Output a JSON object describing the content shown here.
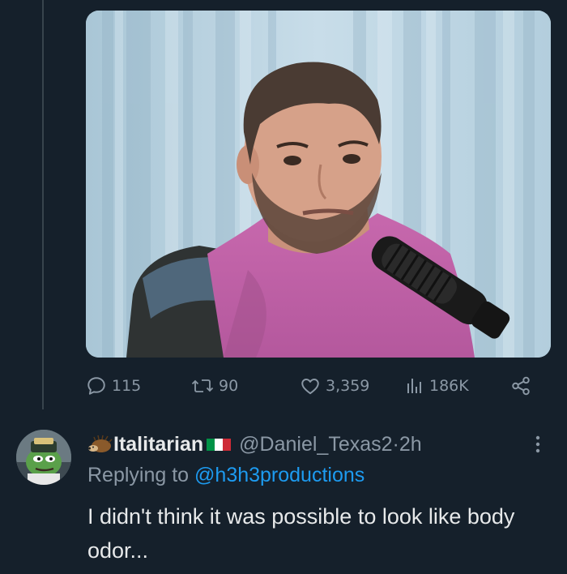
{
  "original_tweet": {
    "stats": {
      "replies": "115",
      "reposts": "90",
      "likes": "3,359",
      "views": "186K"
    }
  },
  "reply": {
    "display_name": "Italitarian",
    "handle": "@Daniel_Texas2",
    "separator": " · ",
    "time": "2h",
    "replying_to_label": "Replying to",
    "replying_to_handle": "@h3h3productions",
    "text": "I didn't think it was possible to look like body odor..."
  },
  "icons": {
    "reply": "comment-bubble-icon",
    "repost": "repost-arrows-icon",
    "like": "heart-icon",
    "views": "bar-chart-icon",
    "share": "share-nodes-icon",
    "more": "vertical-dots-icon"
  },
  "colors": {
    "background": "#15202b",
    "muted": "#8b98a5",
    "link": "#1d9bf0",
    "text": "#e7e9ea"
  }
}
